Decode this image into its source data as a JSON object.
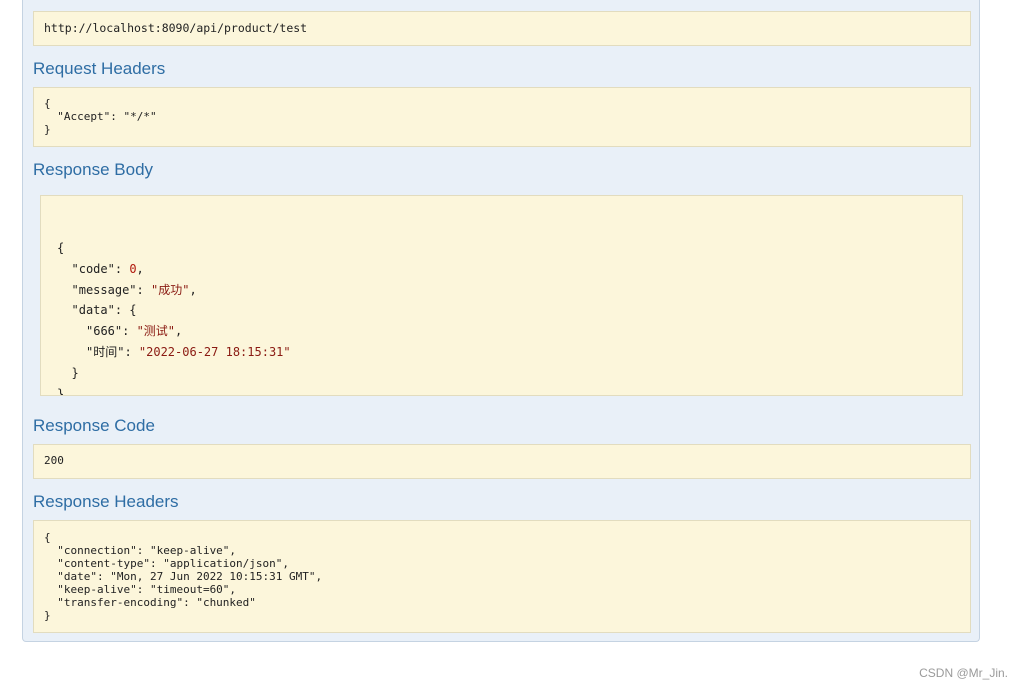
{
  "request_url": {
    "value": "http://localhost:8090/api/product/test"
  },
  "request_headers": {
    "title": "Request Headers",
    "lines": [
      "{",
      "  \"Accept\": \"*/*\"",
      "}"
    ]
  },
  "response_body": {
    "title": "Response Body",
    "lines": [
      {
        "indent": 0,
        "parts": [
          {
            "t": "{",
            "c": "punct"
          }
        ]
      },
      {
        "indent": 1,
        "parts": [
          {
            "t": "\"code\"",
            "c": "key"
          },
          {
            "t": ": ",
            "c": "punct"
          },
          {
            "t": "0",
            "c": "num"
          },
          {
            "t": ",",
            "c": "punct"
          }
        ]
      },
      {
        "indent": 1,
        "parts": [
          {
            "t": "\"message\"",
            "c": "key"
          },
          {
            "t": ": ",
            "c": "punct"
          },
          {
            "t": "\"成功\"",
            "c": "str"
          },
          {
            "t": ",",
            "c": "punct"
          }
        ]
      },
      {
        "indent": 1,
        "parts": [
          {
            "t": "\"data\"",
            "c": "key"
          },
          {
            "t": ": {",
            "c": "punct"
          }
        ]
      },
      {
        "indent": 2,
        "parts": [
          {
            "t": "\"666\"",
            "c": "key"
          },
          {
            "t": ": ",
            "c": "punct"
          },
          {
            "t": "\"测试\"",
            "c": "str"
          },
          {
            "t": ",",
            "c": "punct"
          }
        ]
      },
      {
        "indent": 2,
        "parts": [
          {
            "t": "\"时间\"",
            "c": "key"
          },
          {
            "t": ": ",
            "c": "punct"
          },
          {
            "t": "\"2022-06-27 18:15:31\"",
            "c": "str"
          }
        ]
      },
      {
        "indent": 1,
        "parts": [
          {
            "t": "}",
            "c": "punct"
          }
        ]
      },
      {
        "indent": 0,
        "parts": [
          {
            "t": "}",
            "c": "punct"
          }
        ]
      }
    ]
  },
  "response_code": {
    "title": "Response Code",
    "value": "200"
  },
  "response_headers": {
    "title": "Response Headers",
    "lines": [
      "{",
      "  \"connection\": \"keep-alive\",",
      "  \"content-type\": \"application/json\",",
      "  \"date\": \"Mon, 27 Jun 2022 10:15:31 GMT\",",
      "  \"keep-alive\": \"timeout=60\",",
      "  \"transfer-encoding\": \"chunked\"",
      "}"
    ]
  },
  "watermark": "CSDN @Mr_Jin."
}
